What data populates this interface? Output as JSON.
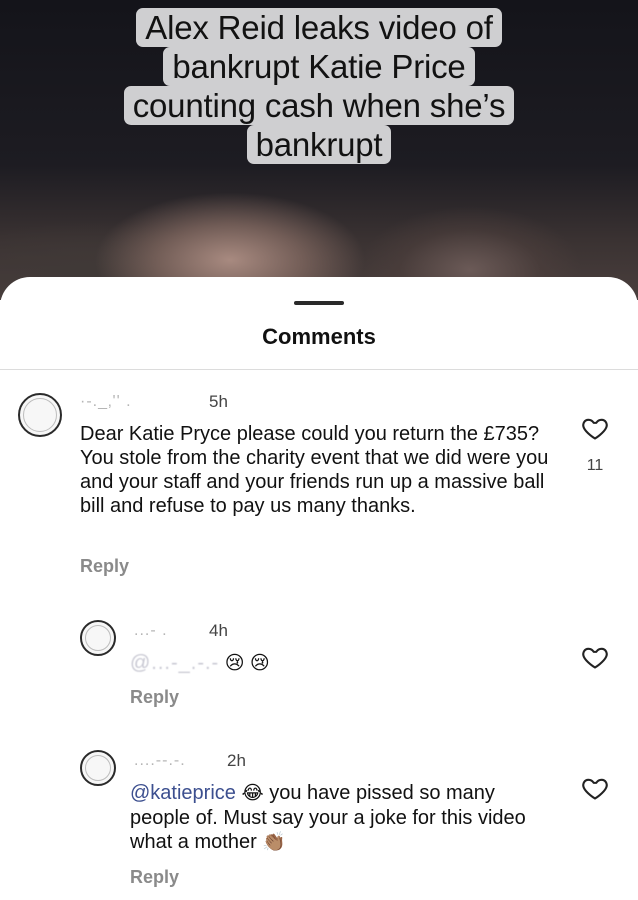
{
  "video": {
    "headline_lines": [
      "Alex Reid leaks video of",
      "bankrupt Katie Price",
      "counting cash when she’s",
      "bankrupt"
    ]
  },
  "sheet": {
    "title": "Comments"
  },
  "comments": [
    {
      "username": "·‑._‚'' .",
      "time": "5h",
      "text": "Dear Katie Pryce please could you return the £735? You stole from the charity event that we did were you and your staff and your friends run up a massive ball bill and refuse to pay us many thanks.",
      "reply_label": "Reply",
      "like_count": "11"
    },
    {
      "username": "...‑ .",
      "time": "4h",
      "mention": "@...‑_.‑.‑",
      "emojis": "😢 😢",
      "reply_label": "Reply"
    },
    {
      "username": "....‑‑.‑.",
      "time": "2h",
      "mention": "@katieprice",
      "emoji_after_mention": "😂",
      "text": "you have pissed so many people of. Must say your a joke for this video what a mother",
      "emoji_end": "👏🏽",
      "reply_label": "Reply"
    }
  ],
  "colors": {
    "mention": "#3c4f8f",
    "reply": "#8a8a8a",
    "headline_bg": "#cfcfd1"
  },
  "icons": [
    "heart-icon"
  ]
}
